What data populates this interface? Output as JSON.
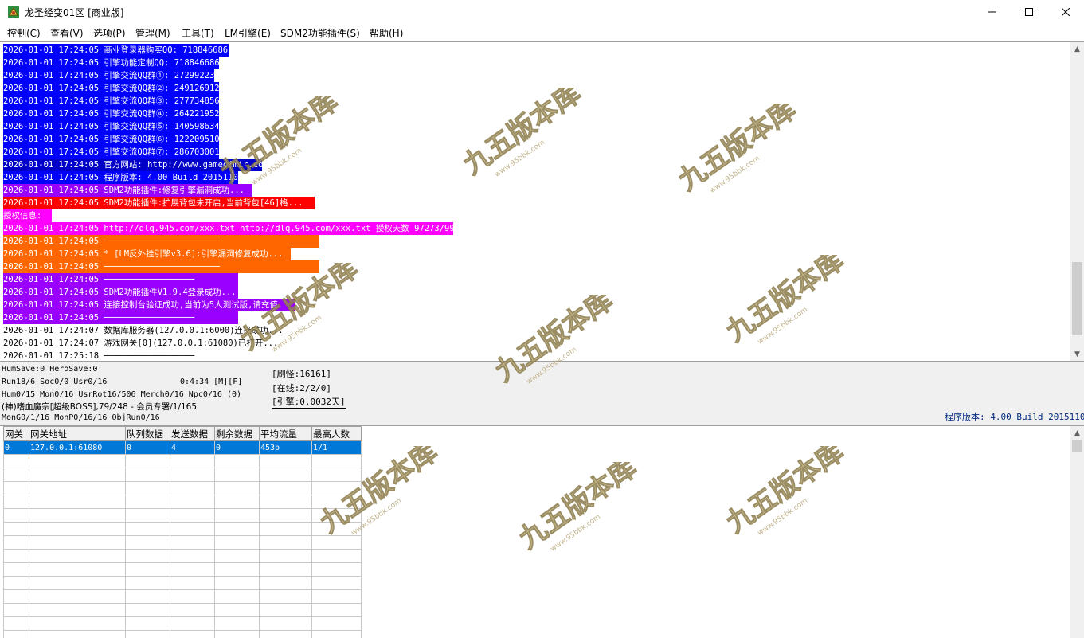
{
  "window": {
    "title": "龙圣经变01区 [商业版]",
    "minimize_glyph": "—",
    "maximize_glyph": "☐",
    "close_glyph": "✕"
  },
  "menu": [
    "控制(C)",
    "查看(V)",
    "选项(P)",
    "管理(M)",
    "工具(T)",
    "LM引擎(E)",
    "SDM2功能插件(S)",
    "帮助(H)"
  ],
  "log": [
    {
      "text": "2026-01-01 17:24:05 商业登录器购买QQ: 718846686",
      "bg": "#0000ff",
      "fg": "#ffffff"
    },
    {
      "text": "2026-01-01 17:24:05 引擎功能定制QQ: 718846686",
      "bg": "#0000ff",
      "fg": "#ffffff"
    },
    {
      "text": "2026-01-01 17:24:05 引擎交流QQ群①: 27299223",
      "bg": "#0000ff",
      "fg": "#ffffff"
    },
    {
      "text": "2026-01-01 17:24:05 引擎交流QQ群②: 249126912",
      "bg": "#0000ff",
      "fg": "#ffffff"
    },
    {
      "text": "2026-01-01 17:24:05 引擎交流QQ群③: 277734856",
      "bg": "#0000ff",
      "fg": "#ffffff"
    },
    {
      "text": "2026-01-01 17:24:05 引擎交流QQ群④: 264221952",
      "bg": "#0000ff",
      "fg": "#ffffff"
    },
    {
      "text": "2026-01-01 17:24:05 引擎交流QQ群⑤: 140598634",
      "bg": "#0000ff",
      "fg": "#ffffff"
    },
    {
      "text": "2026-01-01 17:24:05 引擎交流QQ群⑥: 122209510",
      "bg": "#0000ff",
      "fg": "#ffffff"
    },
    {
      "text": "2026-01-01 17:24:05 引擎交流QQ群⑦: 286703001",
      "bg": "#0000ff",
      "fg": "#ffffff"
    },
    {
      "text": "2026-01-01 17:24:05 官方网站: http://www.gameofmir.com",
      "bg": "#0000c8",
      "fg": "#ffffff"
    },
    {
      "text": "2026-01-01 17:24:05 程序版本: 4.00 Build 20151104",
      "bg": "#0000ff",
      "fg": "#ffffff"
    },
    {
      "text": "2026-01-01 17:24:05 SDM2功能插件:修复引擎漏洞成功...",
      "bg": "#9900ff",
      "fg": "#ffffff"
    },
    {
      "text": "2026-01-01 17:24:05 SDM2功能插件:扩展背包未开启,当前背包[46]格...",
      "bg": "#ff0000",
      "fg": "#ffffff"
    },
    {
      "text": "授权信息:",
      "bg": "#ff00ff",
      "fg": "#ffffff"
    },
    {
      "text": "2026-01-01 17:24:05 http://dlq.945.com/xxx.txt http://dlq.945.com/xxx.txt 授权天数 97273/99999",
      "bg": "#ff00ff",
      "fg": "#ffffff"
    },
    {
      "text": "2026-01-01 17:24:05 ───────────────────────",
      "bg": "#ff6600",
      "fg": "#ffffff"
    },
    {
      "text": "2026-01-01 17:24:05 * [LM反外挂引擎v3.6]:引擎漏洞修复成功...",
      "bg": "#ff6600",
      "fg": "#ffffff"
    },
    {
      "text": "2026-01-01 17:24:05 ───────────────────────",
      "bg": "#ff6600",
      "fg": "#ffffff"
    },
    {
      "text": "2026-01-01 17:24:05 ──────────────────",
      "bg": "#9900ff",
      "fg": "#ffffff"
    },
    {
      "text": "2026-01-01 17:24:05 SDM2功能插件V1.9.4登录成功...",
      "bg": "#9900ff",
      "fg": "#ffffff"
    },
    {
      "text": "2026-01-01 17:24:05 连接控制台验证成功,当前为5人测试版,请充值",
      "bg": "#9900ff",
      "fg": "#ffffff"
    },
    {
      "text": "2026-01-01 17:24:05 ──────────────────",
      "bg": "#9900ff",
      "fg": "#ffffff"
    },
    {
      "text": "2026-01-01 17:24:07 数据库服务器(127.0.0.1:6000)连接成功...",
      "bg": "#ffffff",
      "fg": "#000000"
    },
    {
      "text": "2026-01-01 17:24:07 游戏网关[0](127.0.0.1:61080)已打开...",
      "bg": "#ffffff",
      "fg": "#000000"
    },
    {
      "text": "2026-01-01 17:25:18 ──────────────────",
      "bg": "#ffffff",
      "fg": "#000000"
    }
  ],
  "status": {
    "hum_save": "HumSave:0 HeroSave:0",
    "run": "Run18/6 Soc0/0 Usr0/16",
    "timer": "0:4:34 [M][F]",
    "hum": "Hum0/15 Mon0/16 UsrRot16/506 Merch0/16 Npc0/16 (0)",
    "boss": "(神)嗜血魔宗[超级BOSS],79/248 - 会员专署/1/165",
    "mon": "MonG0/1/16 MonP0/16/16 ObjRun0/16",
    "refresh": "[刷怪:16161]",
    "online": "[在线:2/2/0]",
    "engine": "[引擎:0.0032天]",
    "version": "程序版本: 4.00 Build 20151104"
  },
  "gateway_table": {
    "columns": [
      "网关",
      "网关地址",
      "队列数据",
      "发送数据",
      "剩余数据",
      "平均流量",
      "最高人数"
    ],
    "rows": [
      [
        "0",
        "127.0.0.1:61080",
        "0",
        "4",
        "0",
        "453b",
        "1/1"
      ]
    ],
    "empty_rows": 14
  },
  "watermark": {
    "text": "九五版本库",
    "url": "www.95bbk.com",
    "color": "#d8c690"
  },
  "icons": {
    "app": "app-icon",
    "scroll_up": "scroll-up-icon",
    "scroll_down": "scroll-down-icon"
  }
}
